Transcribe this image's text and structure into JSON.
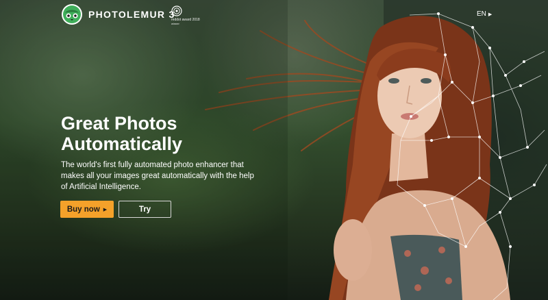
{
  "brand": {
    "name": "PHOTOLEMUR 3",
    "logo_icon": "photolemur-logo-icon"
  },
  "award": {
    "icon": "reddot-award-icon",
    "line1": "reddot award 2018",
    "line2": "winner"
  },
  "language": {
    "label": "EN",
    "icon": "chevron-right-icon"
  },
  "hero": {
    "headline_line1": "Great Photos",
    "headline_line2": "Automatically",
    "description": "The world's first fully automated photo enhancer that makes all your images great automatically with the help of Artificial Intelligence.",
    "image_icon": "portrait-photo-icon"
  },
  "actions": {
    "buy_label": "Buy now",
    "buy_icon": "chevron-right-icon",
    "try_label": "Try"
  },
  "colors": {
    "accent": "#f4a12a",
    "text": "#ffffff",
    "background": "#34502f"
  }
}
